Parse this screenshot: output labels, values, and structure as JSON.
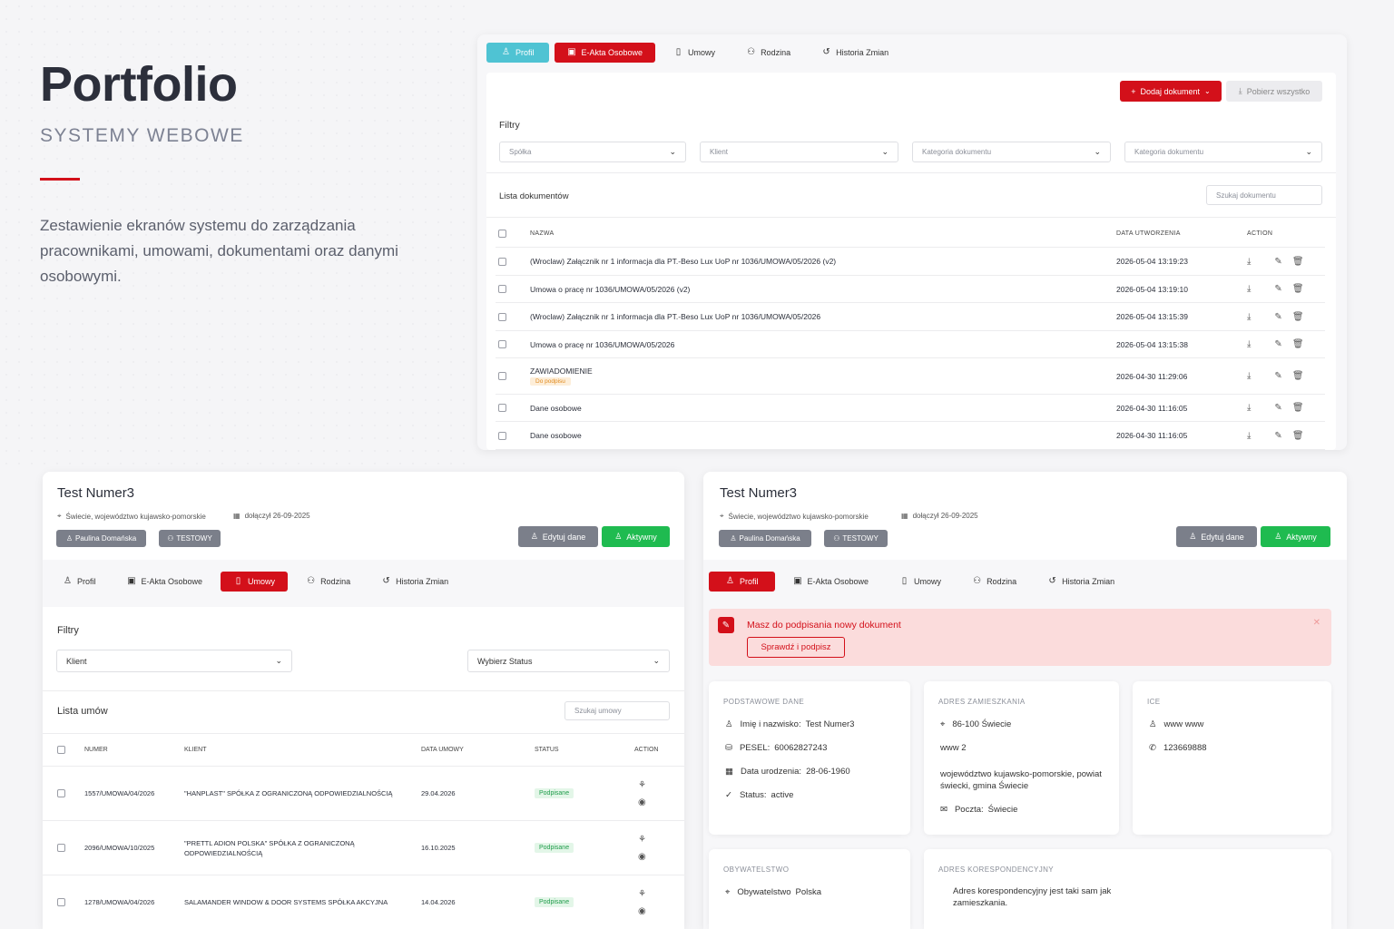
{
  "hero": {
    "title": "Portfolio",
    "subtitle": "SYSTEMY WEBOWE",
    "description": "Zestawienie ekranów systemu do zarządzania pracownikami, umowami, dokumentami oraz danymi osobowymi.",
    "accent": "#d3101a"
  },
  "top": {
    "tabs": [
      {
        "label": "Profil",
        "icon": "user-icon"
      },
      {
        "label": "E-Akta Osobowe",
        "icon": "folder-icon"
      },
      {
        "label": "Umowy",
        "icon": "document-icon"
      },
      {
        "label": "Rodzina",
        "icon": "users-icon"
      },
      {
        "label": "Historia Zmian",
        "icon": "history-icon"
      }
    ],
    "add_button": "Dodaj dokument",
    "download_all": "Pobierz wszystko",
    "filters_title": "Filtry",
    "filters": [
      "Spółka",
      "Klient",
      "Kategoria dokumentu",
      "Kategoria dokumentu"
    ],
    "list_title": "Lista dokumentów",
    "search_placeholder": "Szukaj dokumentu",
    "columns": {
      "name": "NAZWA",
      "date": "DATA UTWORZENIA",
      "action": "ACTION"
    },
    "rows": [
      {
        "name": "(Wroclaw) Załącznik nr 1 informacja dla PT.-Beso Lux UoP nr 1036/UMOWA/05/2026 (v2)",
        "date": "2026-05-04 13:19:23",
        "badge": ""
      },
      {
        "name": "Umowa o pracę nr 1036/UMOWA/05/2026 (v2)",
        "date": "2026-05-04 13:19:10",
        "badge": ""
      },
      {
        "name": "(Wroclaw) Załącznik nr 1 informacja dla PT.-Beso Lux UoP nr 1036/UMOWA/05/2026",
        "date": "2026-05-04 13:15:39",
        "badge": ""
      },
      {
        "name": "Umowa o pracę nr 1036/UMOWA/05/2026",
        "date": "2026-05-04 13:15:38",
        "badge": ""
      },
      {
        "name": "ZAWIADOMIENIE",
        "date": "2026-04-30 11:29:06",
        "badge": "Do podpisu"
      },
      {
        "name": "Dane osobowe",
        "date": "2026-04-30 11:16:05",
        "badge": ""
      },
      {
        "name": "Dane osobowe",
        "date": "2026-04-30 11:16:05",
        "badge": ""
      }
    ]
  },
  "profile": {
    "name": "Test Numer3",
    "location": "Świecie, województwo kujawsko-pomorskie",
    "joined": "dołączył 26-09-2025",
    "chip_user": "Paulina Domańska",
    "chip_test": "TESTOWY",
    "edit_button": "Edytuj dane",
    "active_button": "Aktywny"
  },
  "left": {
    "tabs": [
      "Profil",
      "E-Akta Osobowe",
      "Umowy",
      "Rodzina",
      "Historia Zmian"
    ],
    "filters_title": "Filtry",
    "filter_client": "Klient",
    "filter_status": "Wybierz Status",
    "list_title": "Lista umów",
    "search_placeholder": "Szukaj umowy",
    "columns": {
      "number": "NUMER",
      "client": "KLIENT",
      "date": "DATA UMOWY",
      "status": "STATUS",
      "action": "ACTION"
    },
    "rows": [
      {
        "number": "1557/UMOWA/04/2026",
        "client": "\"HANPLAST\" SPÓŁKA Z OGRANICZONĄ ODPOWIEDZIALNOŚCIĄ",
        "date": "29.04.2026",
        "status": "Podpisane"
      },
      {
        "number": "2096/UMOWA/10/2025",
        "client": "\"PRETTL ADION POLSKA\" SPÓŁKA Z OGRANICZONĄ ODPOWIEDZIALNOŚCIĄ",
        "date": "16.10.2025",
        "status": "Podpisane"
      },
      {
        "number": "1278/UMOWA/04/2026",
        "client": "SALAMANDER WINDOW & DOOR SYSTEMS SPÓŁKA AKCYJNA",
        "date": "14.04.2026",
        "status": "Podpisane"
      }
    ]
  },
  "right": {
    "tabs": [
      "Profil",
      "E-Akta Osobowe",
      "Umowy",
      "Rodzina",
      "Historia Zmian"
    ],
    "alert_text": "Masz do podpisania nowy dokument",
    "alert_button": "Sprawdź i podpisz",
    "basic": {
      "caption": "PODSTAWOWE DANE",
      "name_label": "Imię i nazwisko:",
      "name": "Test Numer3",
      "pesel_label": "PESEL:",
      "pesel": "60062827243",
      "birth_label": "Data urodzenia:",
      "birth": "28-06-1960",
      "status_label": "Status:",
      "status": "active"
    },
    "address": {
      "caption": "ADRES ZAMIESZKANIA",
      "city": "86-100 Świecie",
      "line2": "www 2",
      "region": "województwo kujawsko-pomorskie, powiat świecki, gmina Świecie",
      "post_label": "Poczta:",
      "post": "Świecie"
    },
    "ice": {
      "caption": "ICE",
      "name": "www www",
      "phone": "123669888"
    },
    "citizenship": {
      "caption": "OBYWATELSTWO",
      "label": "Obywatelstwo",
      "value": "Polska"
    },
    "correspondence": {
      "caption": "ADRES KORESPONDENCYJNY",
      "text": "Adres korespondencyjny jest taki sam jak zamieszkania."
    }
  }
}
